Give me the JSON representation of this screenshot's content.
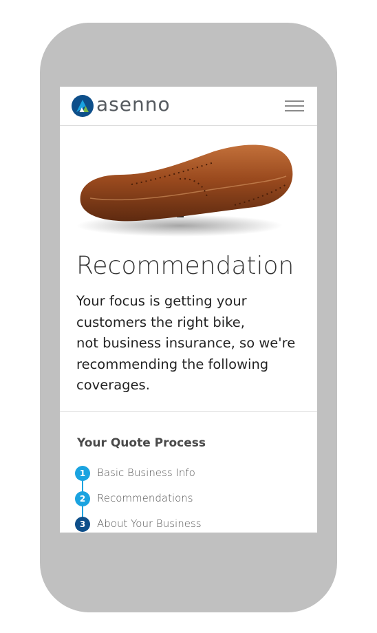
{
  "header": {
    "brand": "asenno",
    "logo_icon": "asenno-logo-icon",
    "menu_icon": "hamburger-menu-icon"
  },
  "hero": {
    "image": "leather-bike-saddle"
  },
  "main": {
    "title": "Recommendation",
    "description_lines": [
      "Your focus is getting your",
      "customers the right bike,",
      "not business insurance, so we're",
      "recommending the following",
      "coverages."
    ]
  },
  "process": {
    "title": "Your Quote Process",
    "steps": [
      {
        "number": "1",
        "label": "Basic Business Info",
        "color": "#1aa3e0"
      },
      {
        "number": "2",
        "label": "Recommendations",
        "color": "#1aa3e0"
      },
      {
        "number": "3",
        "label": "About Your Business",
        "color": "#0e4f8a"
      }
    ]
  },
  "colors": {
    "brand_blue": "#0e4f8a",
    "accent_blue": "#1aa3e0",
    "logo_green": "#7ab648",
    "saddle_brown": "#9a4a1e"
  }
}
